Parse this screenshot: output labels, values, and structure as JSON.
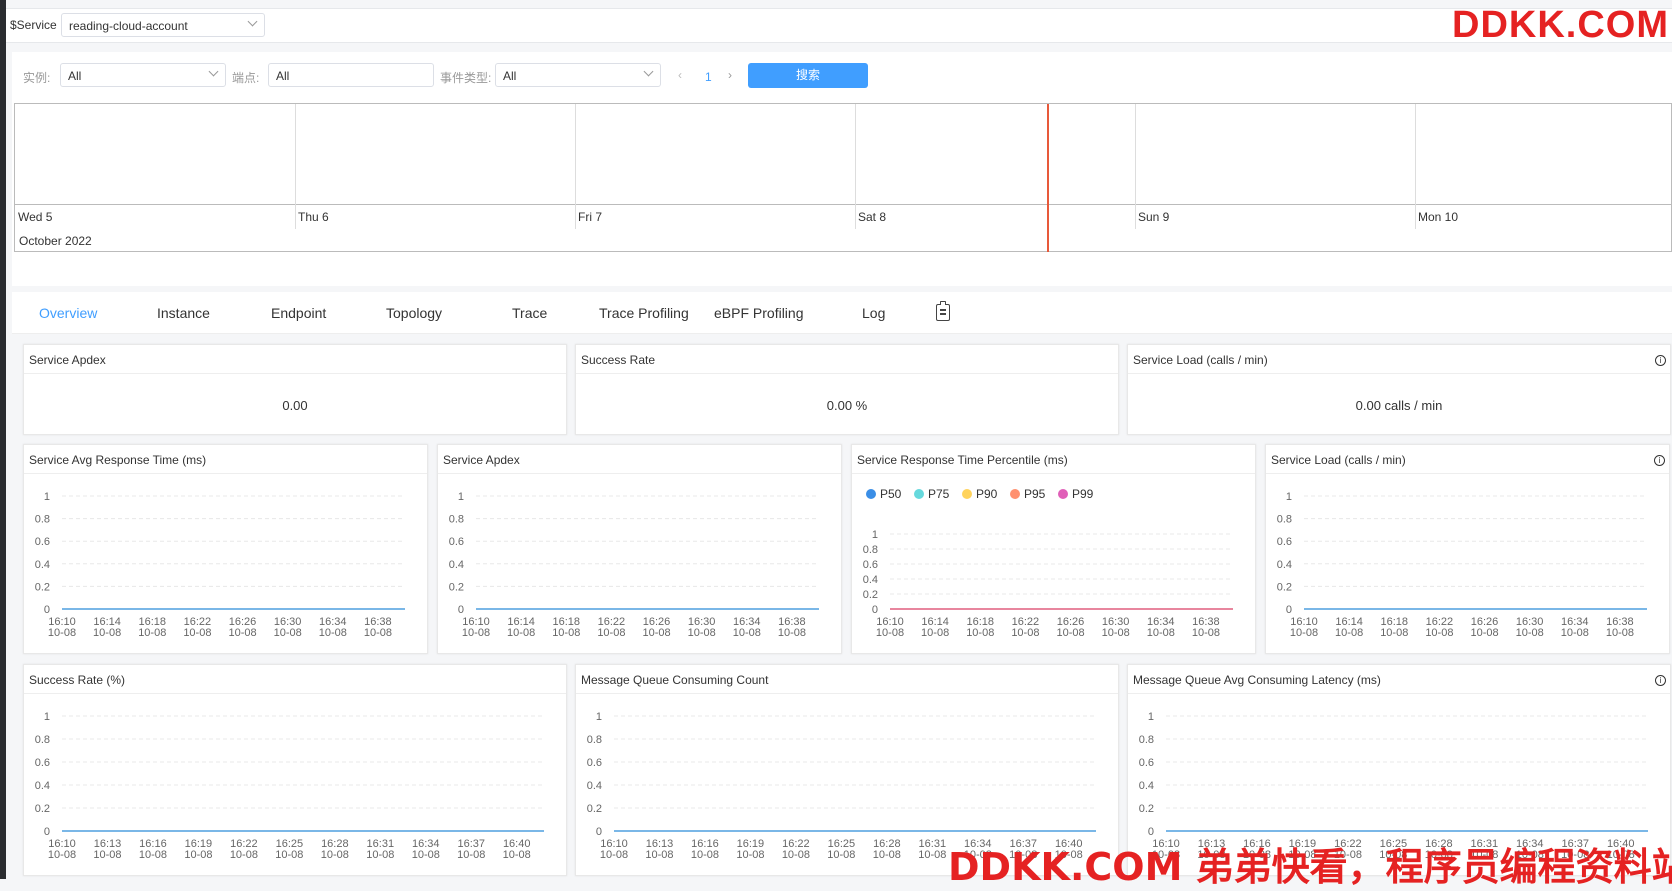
{
  "topbar": {
    "service_label": "$Service",
    "service_value": "reading-cloud-account"
  },
  "watermark": {
    "top": "DDKK.COM",
    "bottom": "DDKK.COM 弟弟快看，程序员编程资料站"
  },
  "filters": {
    "instance_label": "实例:",
    "instance_value": "All",
    "endpoint_label": "端点:",
    "endpoint_value": "All",
    "event_label": "事件类型:",
    "event_value": "All",
    "page": "1",
    "search_label": "搜索"
  },
  "timeline": {
    "days": [
      "Wed 5",
      "Thu 6",
      "Fri 7",
      "Sat 8",
      "Sun 9",
      "Mon 10"
    ],
    "month": "October 2022"
  },
  "tabs": [
    "Overview",
    "Instance",
    "Endpoint",
    "Topology",
    "Trace",
    "Trace Profiling",
    "eBPF Profiling",
    "Log"
  ],
  "stats": [
    {
      "title": "Service Apdex",
      "value": "0.00"
    },
    {
      "title": "Success Rate",
      "value": "0.00 %"
    },
    {
      "title": "Service Load (calls / min)",
      "value": "0.00 calls / min"
    }
  ],
  "info_glyph": "i",
  "chart_data": [
    {
      "type": "line",
      "title": "Service Avg Response Time (ms)",
      "ylim": [
        0,
        1
      ],
      "yticks": [
        "1",
        "0.8",
        "0.6",
        "0.4",
        "0.2",
        "0"
      ],
      "x": [
        "16:10\n10-08",
        "16:14\n10-08",
        "16:18\n10-08",
        "16:22\n10-08",
        "16:26\n10-08",
        "16:30\n10-08",
        "16:34\n10-08",
        "16:38\n10-08"
      ],
      "series": [
        {
          "values": [
            0,
            0,
            0,
            0,
            0,
            0,
            0,
            0
          ],
          "color": "#4e9fdf"
        }
      ]
    },
    {
      "type": "line",
      "title": "Service Apdex",
      "ylim": [
        0,
        1
      ],
      "yticks": [
        "1",
        "0.8",
        "0.6",
        "0.4",
        "0.2",
        "0"
      ],
      "x": [
        "16:10\n10-08",
        "16:14\n10-08",
        "16:18\n10-08",
        "16:22\n10-08",
        "16:26\n10-08",
        "16:30\n10-08",
        "16:34\n10-08",
        "16:38\n10-08"
      ],
      "series": [
        {
          "values": [
            0,
            0,
            0,
            0,
            0,
            0,
            0,
            0
          ],
          "color": "#4e9fdf"
        }
      ]
    },
    {
      "type": "line",
      "title": "Service Response Time Percentile (ms)",
      "ylim": [
        0,
        1
      ],
      "yticks": [
        "1",
        "0.8",
        "0.6",
        "0.4",
        "0.2",
        "0"
      ],
      "legend": [
        {
          "name": "P50",
          "color": "#3a8ee6"
        },
        {
          "name": "P75",
          "color": "#66d9dd"
        },
        {
          "name": "P90",
          "color": "#ffd35c"
        },
        {
          "name": "P95",
          "color": "#ff9170"
        },
        {
          "name": "P99",
          "color": "#e05fb8"
        }
      ],
      "x": [
        "16:10\n10-08",
        "16:14\n10-08",
        "16:18\n10-08",
        "16:22\n10-08",
        "16:26\n10-08",
        "16:30\n10-08",
        "16:34\n10-08",
        "16:38\n10-08"
      ],
      "series": [
        {
          "values": [
            0,
            0,
            0,
            0,
            0,
            0,
            0,
            0
          ],
          "color": "#e05f7f"
        }
      ]
    },
    {
      "type": "line",
      "title": "Service Load (calls / min)",
      "ylim": [
        0,
        1
      ],
      "yticks": [
        "1",
        "0.8",
        "0.6",
        "0.4",
        "0.2",
        "0"
      ],
      "x": [
        "16:10\n10-08",
        "16:14\n10-08",
        "16:18\n10-08",
        "16:22\n10-08",
        "16:26\n10-08",
        "16:30\n10-08",
        "16:34\n10-08",
        "16:38\n10-08"
      ],
      "series": [
        {
          "values": [
            0,
            0,
            0,
            0,
            0,
            0,
            0,
            0
          ],
          "color": "#4e9fdf"
        }
      ]
    },
    {
      "type": "line",
      "title": "Success Rate (%)",
      "ylim": [
        0,
        1
      ],
      "yticks": [
        "1",
        "0.8",
        "0.6",
        "0.4",
        "0.2",
        "0"
      ],
      "x": [
        "16:10\n10-08",
        "16:13\n10-08",
        "16:16\n10-08",
        "16:19\n10-08",
        "16:22\n10-08",
        "16:25\n10-08",
        "16:28\n10-08",
        "16:31\n10-08",
        "16:34\n10-08",
        "16:37\n10-08",
        "16:40\n10-08"
      ],
      "series": [
        {
          "values": [
            0,
            0,
            0,
            0,
            0,
            0,
            0,
            0,
            0,
            0,
            0
          ],
          "color": "#4e9fdf"
        }
      ]
    },
    {
      "type": "line",
      "title": "Message Queue Consuming Count",
      "ylim": [
        0,
        1
      ],
      "yticks": [
        "1",
        "0.8",
        "0.6",
        "0.4",
        "0.2",
        "0"
      ],
      "x": [
        "16:10\n10-08",
        "16:13\n10-08",
        "16:16\n10-08",
        "16:19\n10-08",
        "16:22\n10-08",
        "16:25\n10-08",
        "16:28\n10-08",
        "16:31\n10-08",
        "16:34\n10-08",
        "16:37\n10-08",
        "16:40\n10-08"
      ],
      "series": [
        {
          "values": [
            0,
            0,
            0,
            0,
            0,
            0,
            0,
            0,
            0,
            0,
            0
          ],
          "color": "#4e9fdf"
        }
      ]
    },
    {
      "type": "line",
      "title": "Message Queue Avg Consuming Latency (ms)",
      "ylim": [
        0,
        1
      ],
      "yticks": [
        "1",
        "0.8",
        "0.6",
        "0.4",
        "0.2",
        "0"
      ],
      "x": [
        "16:10\n10-08",
        "16:13\n10-08",
        "16:16\n10-08",
        "16:19\n10-08",
        "16:22\n10-08",
        "16:25\n10-08",
        "16:28\n10-08",
        "16:31\n10-08",
        "16:34\n10-08",
        "16:37\n10-08",
        "16:40\n10-08"
      ],
      "series": [
        {
          "values": [
            0,
            0,
            0,
            0,
            0,
            0,
            0,
            0,
            0,
            0,
            0
          ],
          "color": "#4e9fdf"
        }
      ]
    }
  ]
}
